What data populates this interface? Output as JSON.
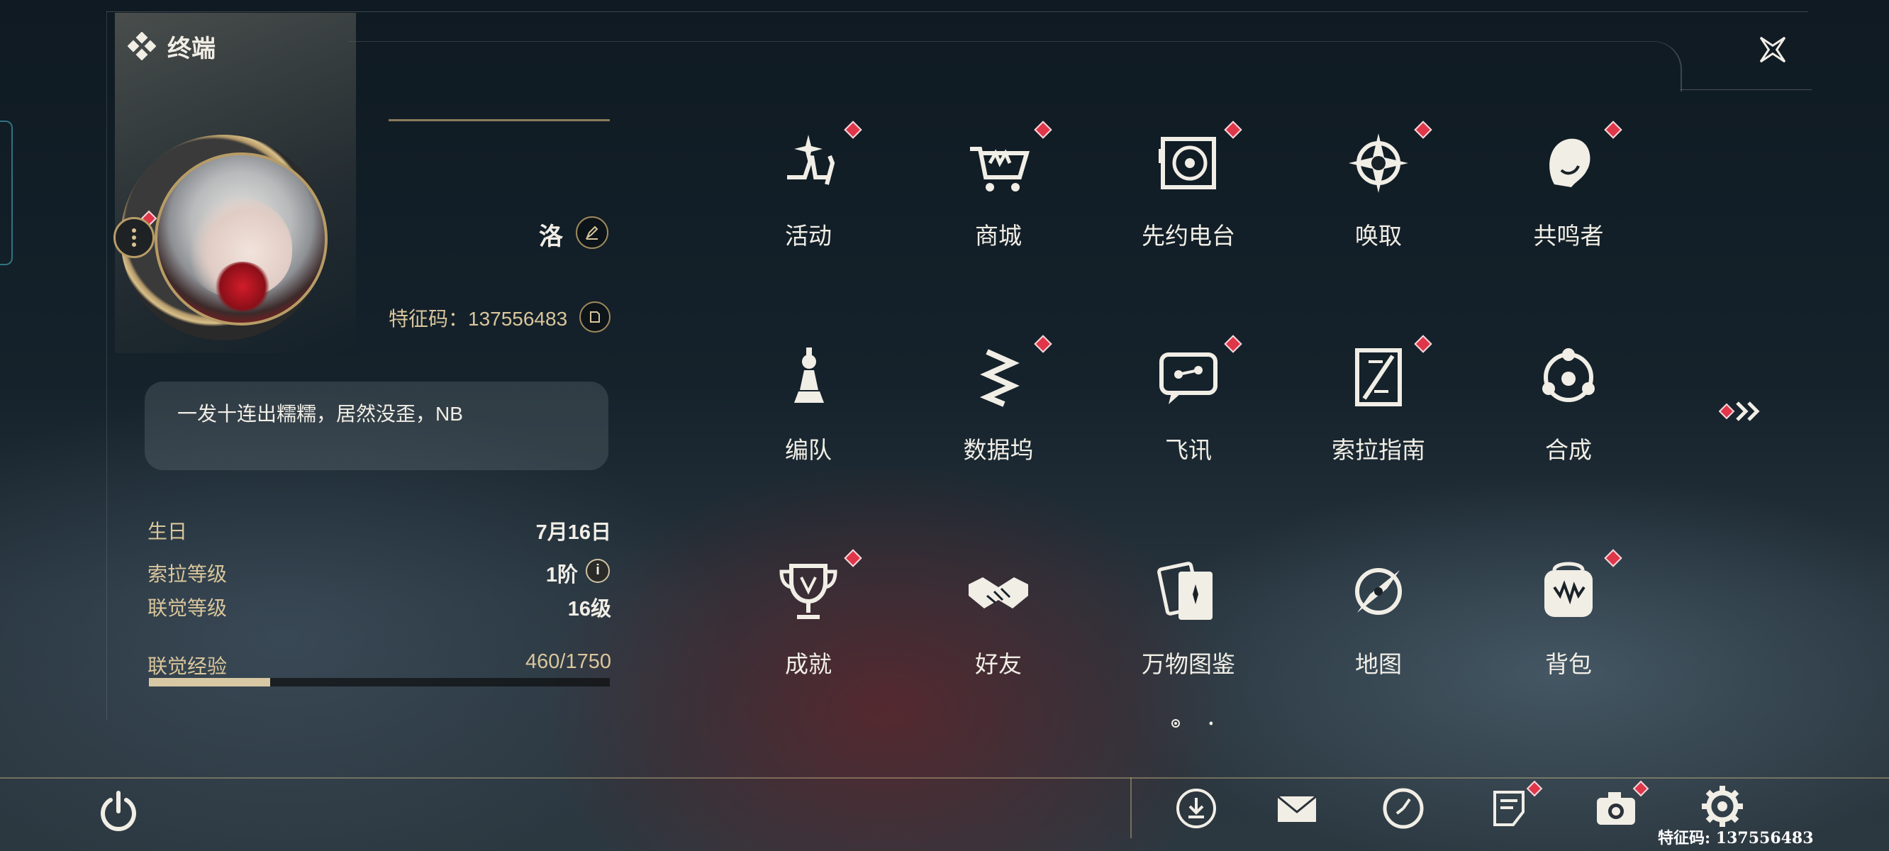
{
  "header": {
    "title": "终端"
  },
  "profile": {
    "name": "洛",
    "uid_text": "特征码：137556483",
    "signature": "一发十连出糯糯，居然没歪，NB",
    "stats": [
      {
        "label": "生日",
        "value": "7月16日"
      },
      {
        "label": "索拉等级",
        "value": "1阶"
      },
      {
        "label": "联觉等级",
        "value": "16级"
      }
    ],
    "xp": {
      "label": "联觉经验",
      "value": "460/1750",
      "fraction": 0.263
    }
  },
  "grid": [
    {
      "label": "活动",
      "icon": "sparkle-icon",
      "badge": true
    },
    {
      "label": "商城",
      "icon": "cart-icon",
      "badge": true
    },
    {
      "label": "先约电台",
      "icon": "radio-icon",
      "badge": true
    },
    {
      "label": "唤取",
      "icon": "compass-star-icon",
      "badge": true
    },
    {
      "label": "共鸣者",
      "icon": "character-icon",
      "badge": true
    },
    {
      "label": "编队",
      "icon": "chess-icon",
      "badge": false
    },
    {
      "label": "数据坞",
      "icon": "data-dock-icon",
      "badge": true
    },
    {
      "label": "飞讯",
      "icon": "chat-icon",
      "badge": true
    },
    {
      "label": "索拉指南",
      "icon": "guide-book-icon",
      "badge": true
    },
    {
      "label": "合成",
      "icon": "synthesis-icon",
      "badge": false
    },
    {
      "label": "成就",
      "icon": "trophy-icon",
      "badge": true
    },
    {
      "label": "好友",
      "icon": "handshake-icon",
      "badge": false
    },
    {
      "label": "万物图鉴",
      "icon": "cards-icon",
      "badge": false
    },
    {
      "label": "地图",
      "icon": "map-compass-icon",
      "badge": false
    },
    {
      "label": "背包",
      "icon": "backpack-icon",
      "badge": true
    }
  ],
  "pagination": {
    "current": 1,
    "total": 2
  },
  "bottom_bar": {
    "icons": [
      "download-icon",
      "mail-icon",
      "clock-icon",
      "notice-icon",
      "camera-icon",
      "settings-icon"
    ],
    "uid_text": "特征码: 137556483"
  },
  "colors": {
    "accent_gold": "#d9c69b",
    "badge_red": "#e0364a",
    "text": "#f1eee6"
  }
}
